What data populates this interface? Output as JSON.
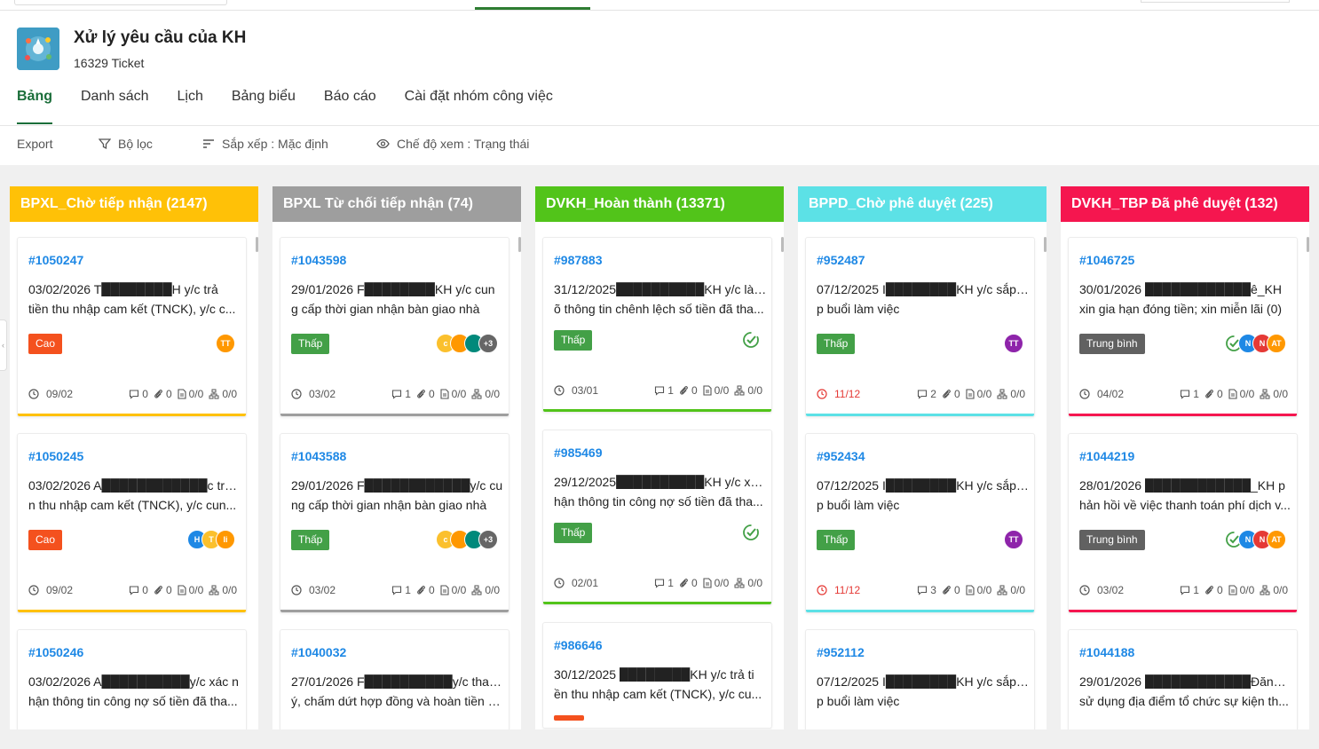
{
  "app": {
    "title": "Xử lý yêu cầu của KH",
    "ticket_count": "16329 Ticket"
  },
  "tabs": [
    "Bảng",
    "Danh sách",
    "Lịch",
    "Bảng biểu",
    "Báo cáo",
    "Cài đặt nhóm công việc"
  ],
  "toolbar": {
    "export": "Export",
    "filter": "Bộ lọc",
    "sort": "Sắp xếp : Mặc định",
    "view": "Chế độ xem : Trạng thái"
  },
  "colors": {
    "cao": "#f4511e",
    "thap": "#43a047",
    "trung_binh": "#616161",
    "link": "#1e88e5",
    "brand": "#1b6e3a"
  },
  "columns": [
    {
      "title": "BPXL_Chờ tiếp nhận (2147)",
      "color": "#ffc107",
      "cards": [
        {
          "id": "#1050247",
          "line1": "03/02/2026 T████████H y/c trả",
          "line2": "tiền thu nhập cam kết (TNCK), y/c c...",
          "priority": "Cao",
          "avatars": [
            "TT"
          ],
          "due": "09/02",
          "comments": "0",
          "attach": "0",
          "docs": "0/0",
          "subtasks": "0/0"
        },
        {
          "id": "#1050245",
          "line1": "03/02/2026 A████████████c trả tiề",
          "line2": "n thu nhập cam kết (TNCK), y/c cun...",
          "priority": "Cao",
          "avatars": [
            "H",
            "T",
            "Ii"
          ],
          "due": "09/02",
          "comments": "0",
          "attach": "0",
          "docs": "0/0",
          "subtasks": "0/0"
        },
        {
          "id": "#1050246",
          "line1": "03/02/2026 A██████████y/c xác n",
          "line2": "hận thông tin công nợ số tiền đã tha...",
          "priority": "",
          "avatars": [],
          "due": "",
          "comments": "",
          "attach": "",
          "docs": "",
          "subtasks": ""
        }
      ]
    },
    {
      "title": "BPXL Từ chối tiếp nhận (74)",
      "color": "#9e9e9e",
      "cards": [
        {
          "id": "#1043598",
          "line1": "29/01/2026 F████████KH y/c cun",
          "line2": "g cấp thời gian nhận bàn giao nhà",
          "priority": "Thấp",
          "avatars": [
            "c",
            "",
            "",
            "+3"
          ],
          "due": "03/02",
          "comments": "1",
          "attach": "0",
          "docs": "0/0",
          "subtasks": "0/0"
        },
        {
          "id": "#1043588",
          "line1": "29/01/2026 F████████████y/c cu",
          "line2": "ng cấp thời gian nhận bàn giao nhà",
          "priority": "Thấp",
          "avatars": [
            "c",
            "",
            "",
            "+3"
          ],
          "due": "03/02",
          "comments": "1",
          "attach": "0",
          "docs": "0/0",
          "subtasks": "0/0"
        },
        {
          "id": "#1040032",
          "line1": "27/01/2026 F██████████y/c thanh l",
          "line2": "ý, chấm dứt hợp đồng và hoàn tiền s...",
          "priority": "",
          "avatars": [],
          "due": "",
          "comments": "",
          "attach": "",
          "docs": "",
          "subtasks": ""
        }
      ]
    },
    {
      "title": "DVKH_Hoàn thành (13371)",
      "color": "#52c41a",
      "cards": [
        {
          "id": "#987883",
          "line1": "31/12/2025██████████KH y/c làm r",
          "line2": "õ thông tin chênh lệch số tiền đã tha...",
          "priority": "Thấp",
          "avatars": [
            "check"
          ],
          "due": "03/01",
          "comments": "1",
          "attach": "0",
          "docs": "0/0",
          "subtasks": "0/0"
        },
        {
          "id": "#985469",
          "line1": "29/12/2025██████████KH y/c xác n",
          "line2": "hận thông tin công nợ số tiền đã tha...",
          "priority": "Thấp",
          "avatars": [
            "check"
          ],
          "due": "02/01",
          "comments": "1",
          "attach": "0",
          "docs": "0/0",
          "subtasks": "0/0"
        },
        {
          "id": "#986646",
          "line1": "30/12/2025 ████████KH y/c trả ti",
          "line2": "ền thu nhập cam kết (TNCK), y/c cu...",
          "priority": "",
          "avatars": [],
          "due": "",
          "comments": "",
          "attach": "",
          "docs": "",
          "subtasks": ""
        }
      ]
    },
    {
      "title": "BPPD_Chờ phê duyệt (225)",
      "color": "#5ce1e6",
      "cards": [
        {
          "id": "#952487",
          "line1": "07/12/2025 I████████KH y/c sắp xế",
          "line2": "p buổi làm việc",
          "priority": "Thấp",
          "avatars": [
            "TT"
          ],
          "due": "11/12",
          "overdue": true,
          "comments": "2",
          "attach": "0",
          "docs": "0/0",
          "subtasks": "0/0"
        },
        {
          "id": "#952434",
          "line1": "07/12/2025 I████████KH y/c sắp xế",
          "line2": "p buổi làm việc",
          "priority": "Thấp",
          "avatars": [
            "TT"
          ],
          "due": "11/12",
          "overdue": true,
          "comments": "3",
          "attach": "0",
          "docs": "0/0",
          "subtasks": "0/0"
        },
        {
          "id": "#952112",
          "line1": "07/12/2025 I████████KH y/c sắp xế",
          "line2": "p buổi làm việc",
          "priority": "",
          "avatars": [],
          "due": "",
          "comments": "",
          "attach": "",
          "docs": "",
          "subtasks": ""
        }
      ]
    },
    {
      "title": "DVKH_TBP Đã phê duyệt (132)",
      "color": "#f5164f",
      "cards": [
        {
          "id": "#1046725",
          "line1": "30/01/2026 ████████████ê_KH",
          "line2": "xin gia hạn đóng tiền; xin miễn lãi (0)",
          "priority": "Trung bình",
          "avatars": [
            "check",
            "N",
            "N",
            "AT"
          ],
          "due": "04/02",
          "comments": "1",
          "attach": "0",
          "docs": "0/0",
          "subtasks": "0/0"
        },
        {
          "id": "#1044219",
          "line1": "28/01/2026 ████████████_KH p",
          "line2": "hản hồi về việc thanh toán phí dịch v...",
          "priority": "Trung bình",
          "avatars": [
            "check",
            "N",
            "N",
            "AT"
          ],
          "due": "03/02",
          "comments": "1",
          "attach": "0",
          "docs": "0/0",
          "subtasks": "0/0"
        },
        {
          "id": "#1044188",
          "line1": "29/01/2026 ████████████Đăng ký",
          "line2": "sử dụng địa điểm tổ chức sự kiện th...",
          "priority": "",
          "avatars": [],
          "due": "",
          "comments": "",
          "attach": "",
          "docs": "",
          "subtasks": ""
        }
      ]
    }
  ]
}
